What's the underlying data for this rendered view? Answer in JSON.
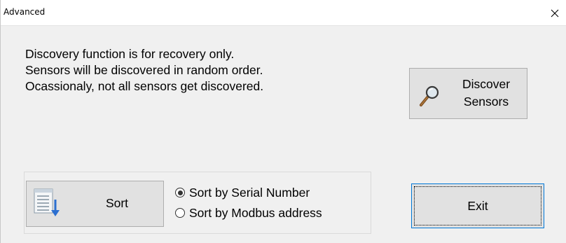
{
  "window": {
    "title": "Advanced",
    "close_icon": "close-icon"
  },
  "message": {
    "lines": [
      "Discovery function is for recovery only.",
      "Sensors will be discovered in random order.",
      "Ocassionaly, not all sensors get discovered."
    ]
  },
  "discover_button": {
    "label_line1": "Discover",
    "label_line2": "Sensors",
    "icon": "magnifier-icon"
  },
  "sort_group": {
    "sort_button": {
      "label": "Sort",
      "icon": "sort-list-icon"
    },
    "options": [
      {
        "label": "Sort by Serial Number",
        "checked": true
      },
      {
        "label": "Sort by Modbus address",
        "checked": false
      }
    ]
  },
  "exit_button": {
    "label": "Exit",
    "focused": true
  },
  "colors": {
    "focus_border": "#0078d7",
    "button_face": "#e1e1e1",
    "dialog_background": "#f0f0f0"
  }
}
